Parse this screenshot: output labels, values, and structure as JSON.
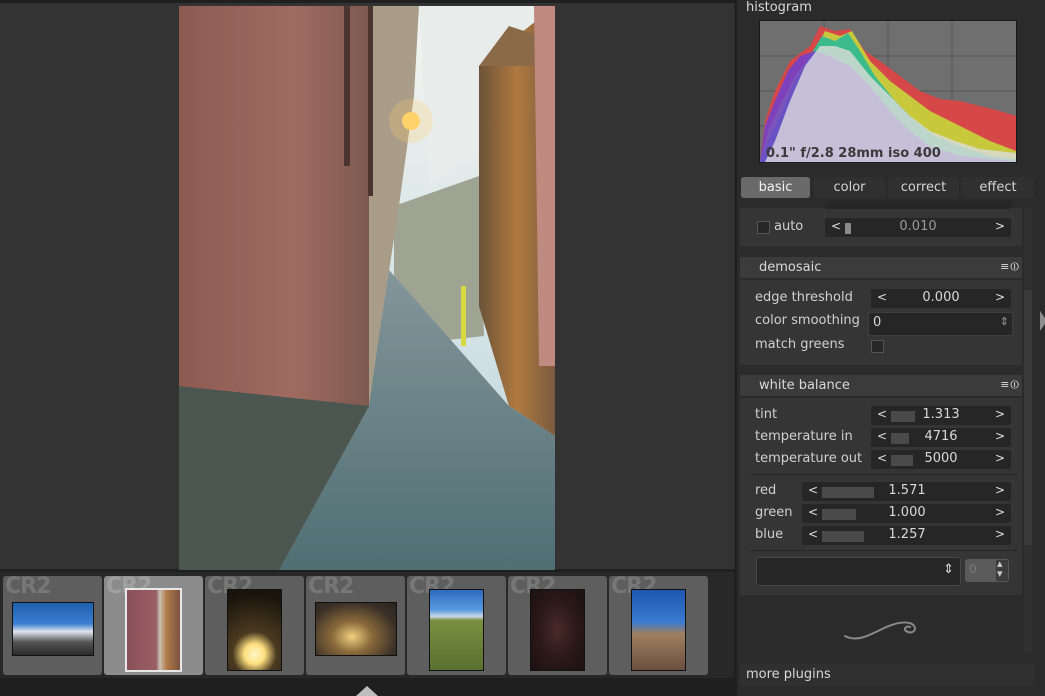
{
  "histogram": {
    "title": "histogram",
    "exif": "0.1\" f/2.8 28mm iso 400"
  },
  "tabs": [
    {
      "label": "basic",
      "active": true
    },
    {
      "label": "color",
      "active": false
    },
    {
      "label": "correct",
      "active": false
    },
    {
      "label": "effect",
      "active": false
    }
  ],
  "exposure": {
    "auto_label": "auto",
    "auto_value": "0.010"
  },
  "demosaic": {
    "title": "demosaic",
    "icons": "≡⏼",
    "edge_threshold_label": "edge threshold",
    "edge_threshold_value": "0.000",
    "color_smoothing_label": "color smoothing",
    "color_smoothing_value": "0",
    "match_greens_label": "match greens"
  },
  "white_balance": {
    "title": "white balance",
    "icons": "≡⏼",
    "tint_label": "tint",
    "tint_value": "1.313",
    "temp_in_label": "temperature in",
    "temp_in_value": "4716",
    "temp_out_label": "temperature out",
    "temp_out_value": "5000",
    "red_label": "red",
    "red_value": "1.571",
    "green_label": "green",
    "green_value": "1.000",
    "blue_label": "blue",
    "blue_value": "1.257",
    "preset_spin_value": "0"
  },
  "filmstrip": {
    "thumbs": [
      {
        "ext": "CR2",
        "active": false
      },
      {
        "ext": "CR2",
        "active": true
      },
      {
        "ext": "CR2",
        "active": false
      },
      {
        "ext": "CR2",
        "active": false
      },
      {
        "ext": "CR2",
        "active": false
      },
      {
        "ext": "CR2",
        "active": false
      },
      {
        "ext": "CR2",
        "active": false
      }
    ]
  },
  "more_plugins": "more plugins",
  "symbols": {
    "lt": "<",
    "gt": ">",
    "updown": "⇕",
    "spin_up": "▴",
    "spin_down": "▾"
  },
  "icons": {
    "module_presets": "hamburger-menu-icon",
    "module_power": "power-icon",
    "collapse_panel": "triangle-right-icon",
    "filmstrip_toggle": "triangle-up-icon",
    "decoration": "swirl-icon"
  }
}
